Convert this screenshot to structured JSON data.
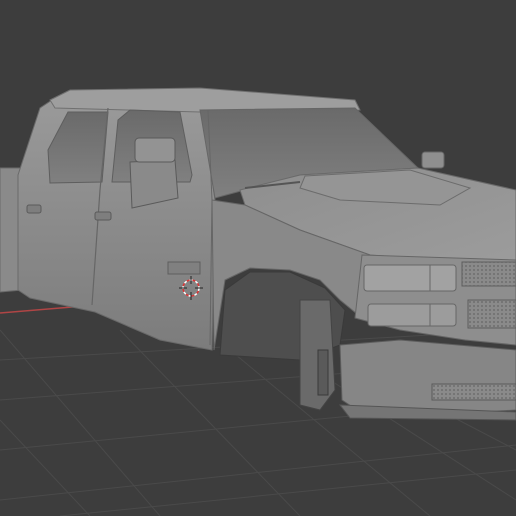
{
  "viewport": {
    "background": "#3d3d3d",
    "grid_color": "#4a4a4a",
    "x_axis_color": "#b04545",
    "model_color": "#8c8c8c"
  },
  "scene": {
    "object": "pickup-truck-model",
    "icons": [
      "3d-cursor-icon"
    ]
  }
}
